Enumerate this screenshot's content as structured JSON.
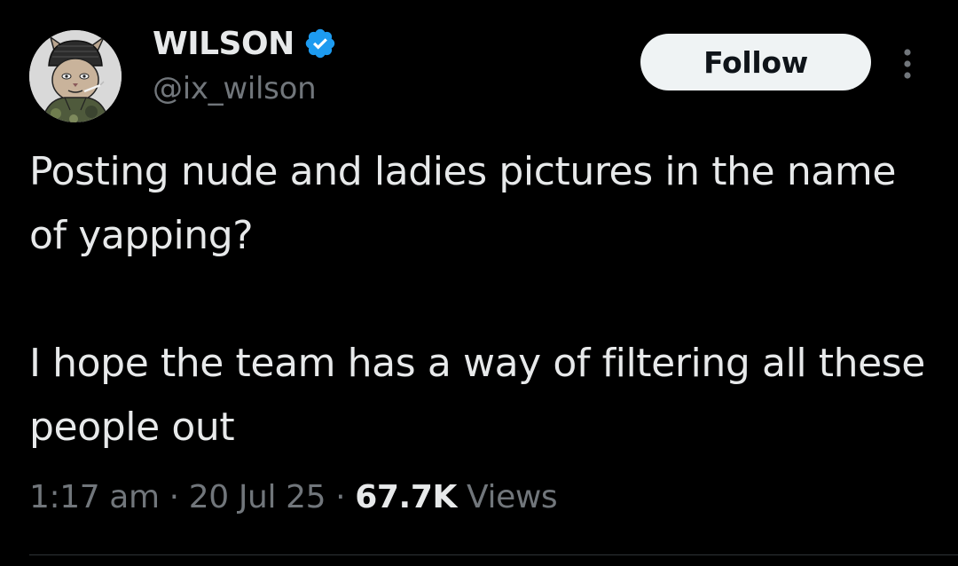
{
  "author": {
    "display_name": "WILSON",
    "handle": "@ix_wilson",
    "verified_icon": "verified-badge-icon",
    "avatar_icon": "cat-avatar-icon"
  },
  "actions": {
    "follow_label": "Follow",
    "more_icon": "more-vertical-icon"
  },
  "tweet": {
    "paragraphs": [
      "Posting nude and ladies pictures in the name of yapping?",
      "I hope the team has a way of filtering all these people out"
    ]
  },
  "meta": {
    "time": "1:17 am",
    "separator": "·",
    "date": "20 Jul 25",
    "views_count": "67.7K",
    "views_label": "Views"
  },
  "colors": {
    "background": "#000000",
    "text_primary": "#e7e9ea",
    "text_secondary": "#71767b",
    "verified_blue": "#1d9bf0",
    "follow_button_bg": "#eff3f4",
    "follow_button_text": "#0f1419",
    "divider": "#2f3336"
  }
}
